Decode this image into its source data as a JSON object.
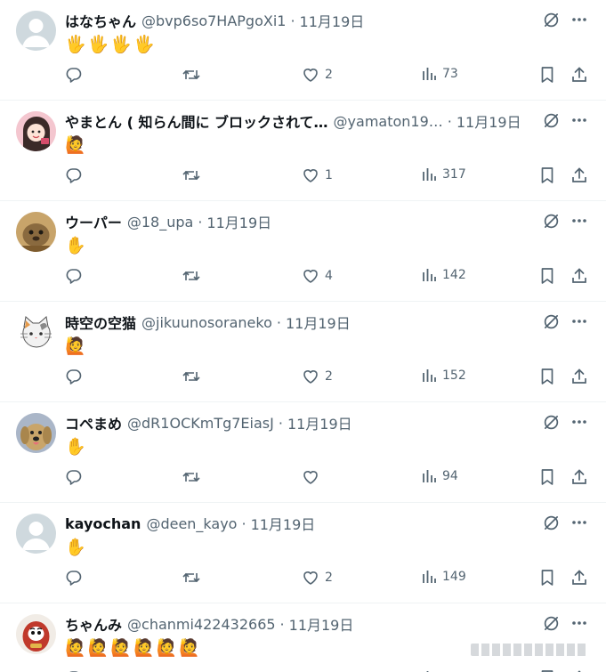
{
  "tweets": [
    {
      "name": "はなちゃん",
      "handle": "@bvp6so7HAPgoXi1",
      "date": "11月19日",
      "body": "🖐🖐🖐🖐",
      "likes": "2",
      "views": "73",
      "avatar": "default-avatar",
      "avatar_color": "#cfd9de"
    },
    {
      "name": "やまとん ( 知らん間に ブロックされて…",
      "handle": "@yamaton19…",
      "date": "11月19日",
      "body": "🙋",
      "likes": "1",
      "views": "317",
      "avatar": "girl-illustration-avatar",
      "avatar_color": "#f4c6cf"
    },
    {
      "name": "ウーパー",
      "handle": "@18_upa",
      "date": "11月19日",
      "body": "✋",
      "likes": "4",
      "views": "142",
      "avatar": "animal-photo-avatar",
      "avatar_color": "#8a6a3f"
    },
    {
      "name": "時空の空猫",
      "handle": "@jikuunosoraneko",
      "date": "11月19日",
      "body": "🙋",
      "likes": "2",
      "views": "152",
      "avatar": "cat-illustration-avatar",
      "avatar_color": "#f2f2f2"
    },
    {
      "name": "コペまめ",
      "handle": "@dR1OCKmTg7EiasJ",
      "date": "11月19日",
      "body": "✋",
      "likes": "",
      "views": "94",
      "avatar": "dog-photo-avatar",
      "avatar_color": "#c9a56a"
    },
    {
      "name": "kayochan",
      "handle": "@deen_kayo",
      "date": "11月19日",
      "body": "✋",
      "likes": "2",
      "views": "149",
      "avatar": "default-avatar",
      "avatar_color": "#cfd9de"
    },
    {
      "name": "ちゃんみ",
      "handle": "@chanmi422432665",
      "date": "11月19日",
      "body": "🙋🙋🙋🙋🙋🙋",
      "likes": "",
      "views": "",
      "avatar": "daruma-avatar",
      "avatar_color": "#c0392b"
    }
  ],
  "colors": {
    "text": "#0f1419",
    "muted": "#536471",
    "divider": "#eff3f4"
  },
  "icons": [
    "grok-icon",
    "more-icon",
    "reply-icon",
    "retweet-icon",
    "like-icon",
    "views-icon",
    "bookmark-icon",
    "share-icon"
  ]
}
